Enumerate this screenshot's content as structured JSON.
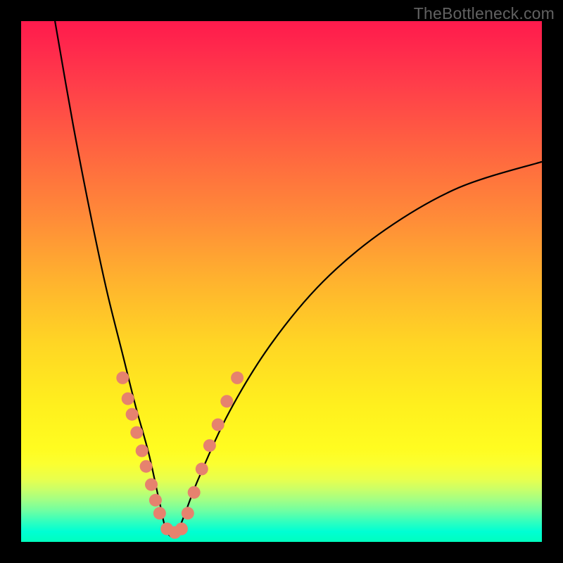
{
  "watermark": "TheBottleneck.com",
  "chart_data": {
    "type": "line",
    "title": "",
    "xlabel": "",
    "ylabel": "",
    "xlim": [
      0,
      1
    ],
    "ylim": [
      0,
      1
    ],
    "note": "V-shaped bottleneck curve over rainbow gradient. Vertex near x≈0.28, y≈0 (green optimal zone). Left branch rises steeply to top; right branch rises to ~y≈0.73 at x=1. Salmon dots cluster near vertex on both branches.",
    "series": [
      {
        "name": "left-branch",
        "x": [
          0.065,
          0.1,
          0.135,
          0.165,
          0.195,
          0.22,
          0.245,
          0.265,
          0.28
        ],
        "y": [
          1.0,
          0.8,
          0.62,
          0.48,
          0.36,
          0.26,
          0.17,
          0.08,
          0.02
        ]
      },
      {
        "name": "right-branch",
        "x": [
          0.3,
          0.34,
          0.4,
          0.48,
          0.58,
          0.7,
          0.84,
          1.0
        ],
        "y": [
          0.02,
          0.12,
          0.25,
          0.38,
          0.5,
          0.6,
          0.68,
          0.73
        ]
      }
    ],
    "markers": [
      {
        "x": 0.195,
        "y": 0.315
      },
      {
        "x": 0.205,
        "y": 0.275
      },
      {
        "x": 0.213,
        "y": 0.245
      },
      {
        "x": 0.222,
        "y": 0.21
      },
      {
        "x": 0.232,
        "y": 0.175
      },
      {
        "x": 0.24,
        "y": 0.145
      },
      {
        "x": 0.25,
        "y": 0.11
      },
      {
        "x": 0.258,
        "y": 0.08
      },
      {
        "x": 0.266,
        "y": 0.055
      },
      {
        "x": 0.28,
        "y": 0.025
      },
      {
        "x": 0.295,
        "y": 0.018
      },
      {
        "x": 0.308,
        "y": 0.025
      },
      {
        "x": 0.32,
        "y": 0.055
      },
      {
        "x": 0.332,
        "y": 0.095
      },
      {
        "x": 0.347,
        "y": 0.14
      },
      {
        "x": 0.362,
        "y": 0.185
      },
      {
        "x": 0.378,
        "y": 0.225
      },
      {
        "x": 0.395,
        "y": 0.27
      },
      {
        "x": 0.415,
        "y": 0.315
      }
    ],
    "colors": {
      "curve": "#000000",
      "markers": "#e6826e",
      "gradient_top": "#ff1a4d",
      "gradient_bottom": "#00ffbe"
    }
  }
}
